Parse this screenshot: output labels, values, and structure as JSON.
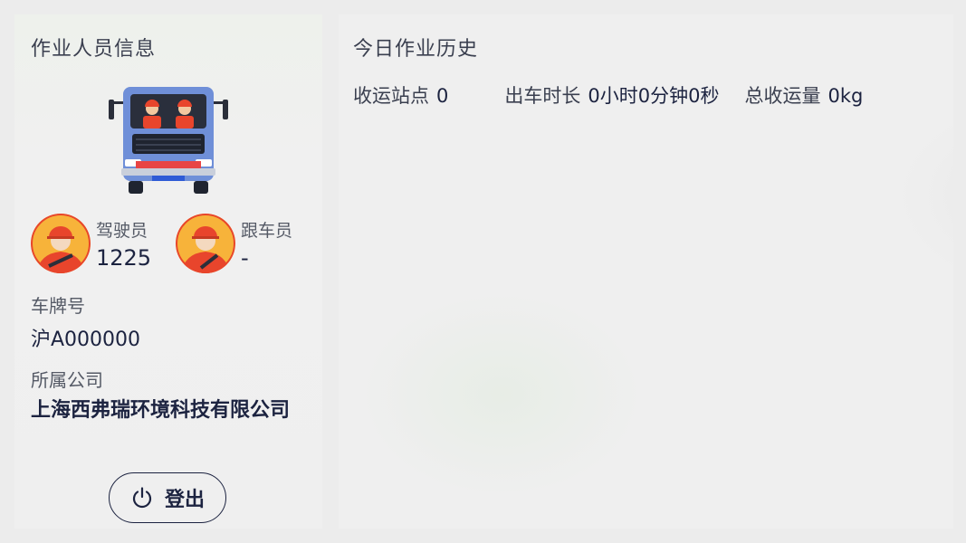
{
  "left_panel": {
    "title": "作业人员信息",
    "driver": {
      "role": "驾驶员",
      "value": "1225"
    },
    "follower": {
      "role": "跟车员",
      "value": "-"
    },
    "plate": {
      "label": "车牌号",
      "value": "沪A000000"
    },
    "company": {
      "label": "所属公司",
      "value": "上海西弗瑞环境科技有限公司"
    },
    "logout_label": "登出"
  },
  "right_panel": {
    "title": "今日作业历史",
    "stats": [
      {
        "label": "收运站点",
        "value": "0"
      },
      {
        "label": "出车时长",
        "value": "0小时0分钟0秒"
      },
      {
        "label": "总收运量",
        "value": "0kg"
      }
    ]
  },
  "colors": {
    "accent": "#1c2340",
    "truck_body": "#6f8fd8",
    "avatar_bg": "#f7b33a",
    "helmet": "#e8452c"
  }
}
